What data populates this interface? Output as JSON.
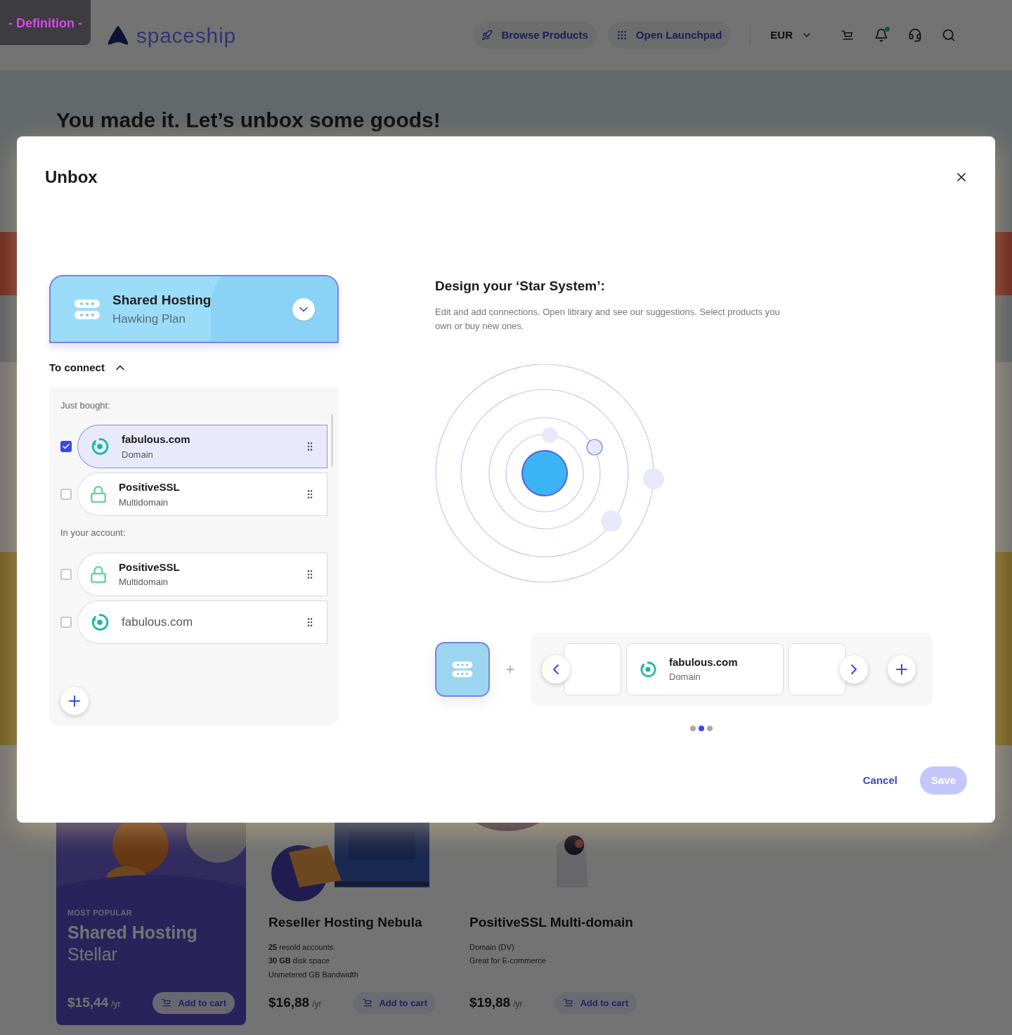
{
  "annotation_label": "- Definition -",
  "header": {
    "logo": "spaceship",
    "nav": [
      {
        "kind": "rocket",
        "label": "Browse Products"
      },
      {
        "kind": "grid",
        "label": "Open Launchpad"
      }
    ],
    "currency": "EUR",
    "notifications_unread": true
  },
  "hero": {
    "title": "You made it. Let’s unbox some goods!"
  },
  "products": [
    {
      "kind": "featured",
      "badge": "MOST POPULAR",
      "title": "Shared Hosting",
      "subtitle": "Stellar",
      "price": "$15,44",
      "period": "/yr",
      "button": "Add to cart"
    },
    {
      "kind": "standard",
      "title": "Reseller Hosting Nebula",
      "features": [
        "**25** resold accounts",
        "**30 GB** disk space",
        "Unmetered GB Bandwidth"
      ],
      "price": "$16,88",
      "period": "/yr",
      "button": "Add to cart"
    },
    {
      "kind": "standard",
      "title": "PositiveSSL Multi-domain",
      "features": [
        "Domain (DV)",
        "Great for E-commerce"
      ],
      "price": "$19,88",
      "period": "/yr",
      "button": "Add to cart"
    }
  ],
  "modal": {
    "title": "Unbox",
    "product": {
      "name": "Shared Hosting",
      "plan": "Hawking Plan"
    },
    "to_connect": {
      "label": "To connect",
      "expanded": true,
      "groups": [
        {
          "label": "Just bought:",
          "items": [
            {
              "kind": "domain",
              "name": "fabulous.com",
              "type": "Domain",
              "checked": true
            },
            {
              "kind": "ssl",
              "name": "PositiveSSL",
              "type": "Multidomain",
              "checked": false
            }
          ]
        },
        {
          "label": "In your account:",
          "items": [
            {
              "kind": "ssl",
              "name": "PositiveSSL",
              "type": "Multidomain",
              "checked": false
            },
            {
              "kind": "domain",
              "name": "fabulous.com",
              "checked": false
            }
          ]
        }
      ]
    },
    "design": {
      "title": "Design your ‘Star System’:",
      "description": "Edit  and add connections. Open library and see our suggestions. Select products you own or buy new ones."
    },
    "carousel": {
      "items": [
        {
          "kind": "empty"
        },
        {
          "kind": "domain",
          "name": "fabulous.com",
          "type": "Domain"
        },
        {
          "kind": "empty"
        }
      ],
      "pages": [
        {
          "selected": false
        },
        {
          "selected": true
        },
        {
          "selected": false
        }
      ]
    },
    "actions": {
      "cancel": "Cancel",
      "save": "Save",
      "save_disabled": true
    }
  }
}
